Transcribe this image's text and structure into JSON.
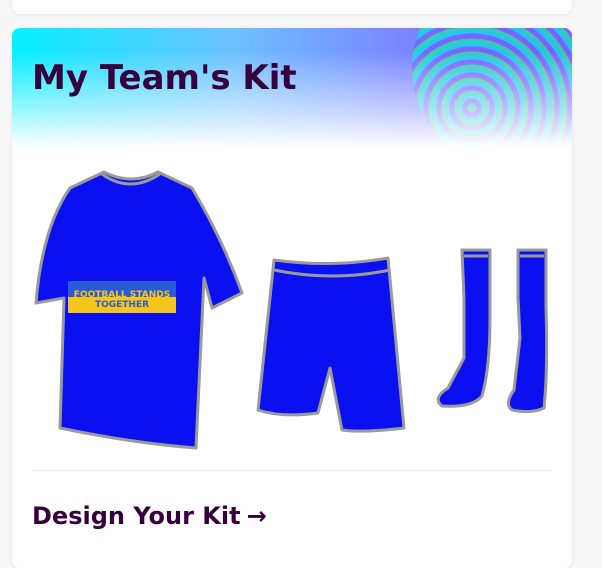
{
  "card": {
    "title": "My Team's Kit",
    "cta_label": "Design Your Kit",
    "cta_arrow": "→"
  },
  "kit": {
    "shirt_color": "#0b10f0",
    "trim_color": "#9a9a9a",
    "badge_line1": "FOOTBALL STANDS",
    "badge_line2": "TOGETHER",
    "badge_top_color": "#2a5bd7",
    "badge_bottom_color": "#f5c518"
  },
  "colors": {
    "title": "#37003c"
  }
}
